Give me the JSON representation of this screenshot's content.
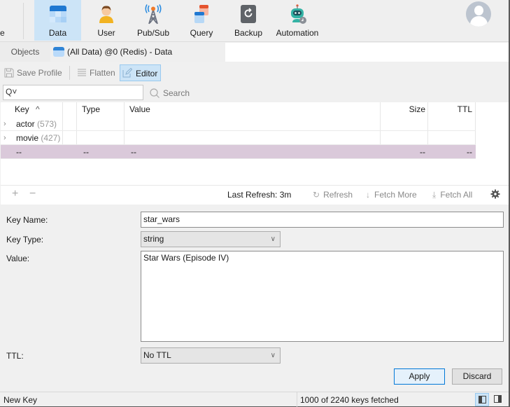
{
  "ribbon": {
    "cut_label": "e",
    "buttons": [
      {
        "label": "Data",
        "icon": "data-table-icon",
        "active": true
      },
      {
        "label": "User",
        "icon": "user-icon",
        "active": false
      },
      {
        "label": "Pub/Sub",
        "icon": "broadcast-tower-icon",
        "active": false
      },
      {
        "label": "Query",
        "icon": "query-icon",
        "active": false
      },
      {
        "label": "Backup",
        "icon": "backup-icon",
        "active": false
      },
      {
        "label": "Automation",
        "icon": "robot-icon",
        "active": false
      }
    ],
    "avatar_icon": "user-avatar-icon"
  },
  "tabs": {
    "objects": "Objects",
    "data": "(All Data) @0 (Redis) - Data"
  },
  "toolbar": {
    "save_profile": "Save Profile",
    "flatten": "Flatten",
    "editor": "Editor"
  },
  "search": {
    "value": "",
    "prefix_icon": "Q˅",
    "button": "Search"
  },
  "grid": {
    "columns": [
      "Key",
      "Type",
      "Value",
      "Size",
      "TTL"
    ],
    "sort_indicator": "^",
    "rows": [
      {
        "key": "actor",
        "count": "(573)",
        "type": "",
        "value": "",
        "size": "",
        "ttl": "",
        "expandable": true,
        "selected": false
      },
      {
        "key": "movie",
        "count": "(427)",
        "type": "",
        "value": "",
        "size": "",
        "ttl": "",
        "expandable": true,
        "selected": false
      },
      {
        "key": "--",
        "count": "",
        "type": "--",
        "value": "--",
        "size": "--",
        "ttl": "--",
        "expandable": false,
        "selected": true
      }
    ],
    "selected_color": "#dac9da"
  },
  "grid_footer": {
    "add": "+",
    "remove": "−",
    "last_refresh": "Last Refresh: 3m",
    "refresh": "Refresh",
    "fetch_more": "Fetch More",
    "fetch_all": "Fetch All"
  },
  "form": {
    "key_name_label": "Key Name:",
    "key_name_value": "star_wars",
    "key_type_label": "Key Type:",
    "key_type_value": "string",
    "value_label": "Value:",
    "value_value": "Star Wars (Episode IV)",
    "ttl_label": "TTL:",
    "ttl_value": "No TTL",
    "apply": "Apply",
    "discard": "Discard"
  },
  "status": {
    "left": "New Key",
    "fetched": "1000 of 2240 keys fetched"
  }
}
